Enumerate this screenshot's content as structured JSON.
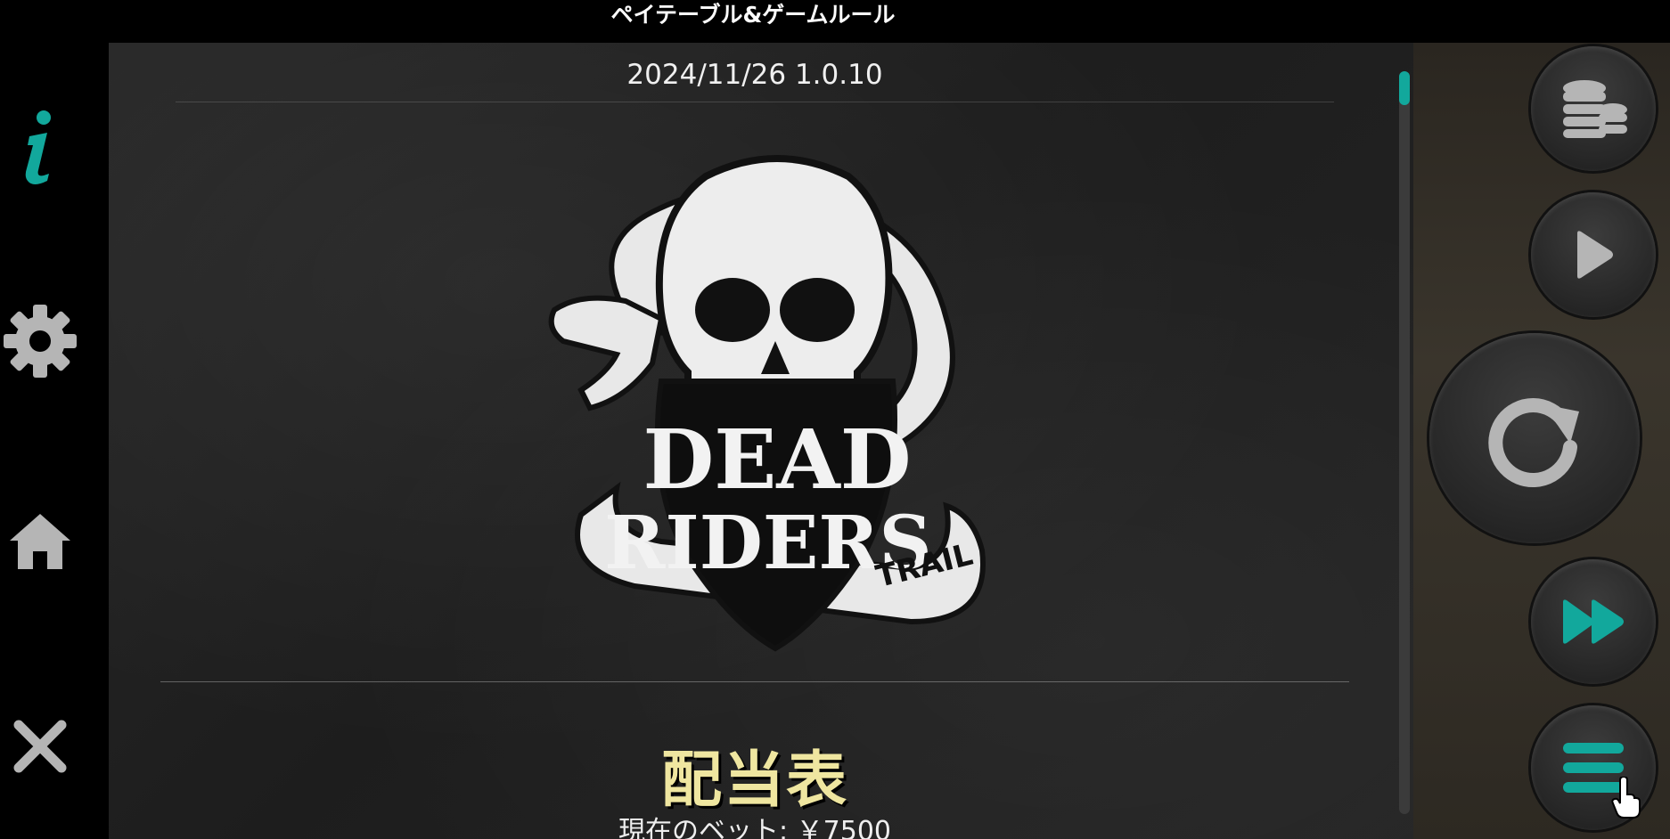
{
  "header": {
    "title": "ペイテーブル&ゲームルール"
  },
  "panel": {
    "version": "2024/11/26 1.0.10",
    "logo": {
      "line1": "DEAD",
      "line2": "RIDERS",
      "tag": "TRAIL"
    },
    "section_title": "配当表",
    "bet_label": "現在のベット:",
    "bet_value": "￥7500"
  },
  "left_nav": [
    {
      "icon": "info-icon"
    },
    {
      "icon": "gear-icon"
    },
    {
      "icon": "home-icon"
    },
    {
      "icon": "close-icon"
    }
  ],
  "right_controls": [
    {
      "icon": "coins-icon"
    },
    {
      "icon": "play-icon"
    },
    {
      "icon": "spin-icon"
    },
    {
      "icon": "fast-forward-icon"
    },
    {
      "icon": "menu-icon"
    }
  ],
  "colors": {
    "accent": "#12a89c",
    "title_yellow": "#efe6a0",
    "icon_gray": "#b5b5b5"
  }
}
